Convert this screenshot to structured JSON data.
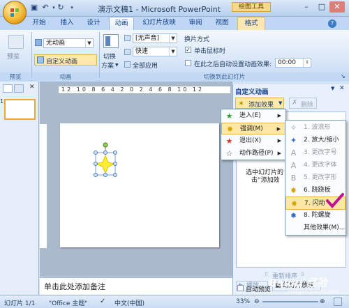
{
  "title": "演示文稿1 - Microsoft PowerPoint",
  "tool_tab_group": "绘图工具",
  "tabs": [
    {
      "label": "开始"
    },
    {
      "label": "插入"
    },
    {
      "label": "设计"
    },
    {
      "label": "动画"
    },
    {
      "label": "幻灯片放映"
    },
    {
      "label": "审阅"
    },
    {
      "label": "视图"
    },
    {
      "label": "格式"
    }
  ],
  "ribbon": {
    "preview_label": "预览",
    "preview_group": "预览",
    "animation_combo": "无动画",
    "custom_animation": "自定义动画",
    "animation_group": "动画",
    "transition_label_1": "切换",
    "transition_label_2": "方案",
    "sound_combo": "[无声音]",
    "speed_combo": "快速",
    "apply_all": "全部应用",
    "advance_title": "换片方式",
    "on_click": "单击鼠标时",
    "auto_after": "在此之后自动设置动画效果:",
    "auto_time": "00:00",
    "transition_group": "切换到此幻灯片"
  },
  "slide_number": "1",
  "ruler_text": "12 10 8 6 4 2 0 2 4 6 8 10 12",
  "notes_placeholder": "单击此处添加备注",
  "task_pane": {
    "title": "自定义动画",
    "add_effect": "添加效果",
    "remove": "删除",
    "hint_1": "选中幻灯片的",
    "hint_2": "击“添加效",
    "reorder": "重新排序",
    "play": "播放",
    "slideshow": "幻灯片放映",
    "autopreview": "自动预览"
  },
  "menu1": [
    {
      "label": "进入(E)",
      "icon": "star-green-icon"
    },
    {
      "label": "强调(M)",
      "icon": "star-burst-icon"
    },
    {
      "label": "退出(X)",
      "icon": "star-red-icon"
    },
    {
      "label": "动作路径(P)",
      "icon": "path-star-icon"
    }
  ],
  "menu2": [
    {
      "label": "1. 波浪形",
      "disabled": true
    },
    {
      "label": "2. 放大/缩小",
      "disabled": false
    },
    {
      "label": "3. 更改字号",
      "disabled": true
    },
    {
      "label": "4. 更改字体",
      "disabled": true
    },
    {
      "label": "5. 更改字形",
      "disabled": true
    },
    {
      "label": "6. 跷跷板",
      "disabled": false
    },
    {
      "label": "7. 闪动",
      "disabled": false
    },
    {
      "label": "8. 陀螺旋",
      "disabled": false
    },
    {
      "label": "其他效果(M)...",
      "disabled": false
    }
  ],
  "status": {
    "slide": "幻灯片 1/1",
    "theme": "\"Office 主题\"",
    "lang": "中文(中国)",
    "zoom": "33%"
  },
  "watermark": "Baidu 经验",
  "watermark_sub": "jingyan.baidu.com",
  "colors": {
    "accent": "#15428b",
    "highlight": "#ffe8a6",
    "check": "#c2138f"
  }
}
